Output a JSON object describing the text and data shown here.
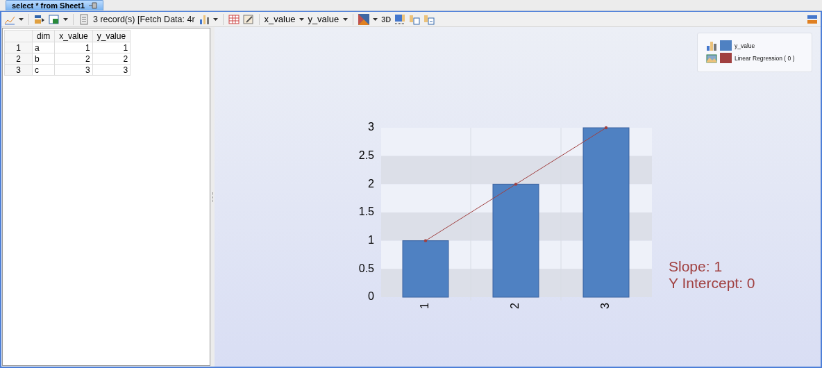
{
  "tab": {
    "title": "select * from Sheet1",
    "selected": true
  },
  "toolbar": {
    "record_info": "3 record(s) [Fetch Data: 4r",
    "x_field": "x_value",
    "y_field": "y_value",
    "three_d": "3D"
  },
  "table": {
    "columns": [
      "",
      "dim",
      "x_value",
      "y_value"
    ],
    "rows": [
      [
        "1",
        "a",
        "1",
        "1"
      ],
      [
        "2",
        "b",
        "2",
        "2"
      ],
      [
        "3",
        "c",
        "3",
        "3"
      ]
    ]
  },
  "chart_data": {
    "type": "bar",
    "categories": [
      "1",
      "2",
      "3"
    ],
    "series": [
      {
        "name": "y_value",
        "color": "#4f81c2",
        "values": [
          1,
          2,
          3
        ]
      },
      {
        "name": "Linear Regression ( 0 )",
        "type": "line",
        "color": "#a04040",
        "values": [
          1,
          2,
          3
        ]
      }
    ],
    "ylim": [
      0,
      3
    ],
    "yticks": [
      0,
      {
        "value": 0.5,
        "label": "0.5"
      },
      1,
      {
        "value": 1.5,
        "label": "1.5"
      },
      2,
      {
        "value": 2.5,
        "label": "2.5"
      },
      3
    ]
  },
  "regression": {
    "slope": "Slope: 1",
    "intercept": "Y Intercept: 0"
  }
}
